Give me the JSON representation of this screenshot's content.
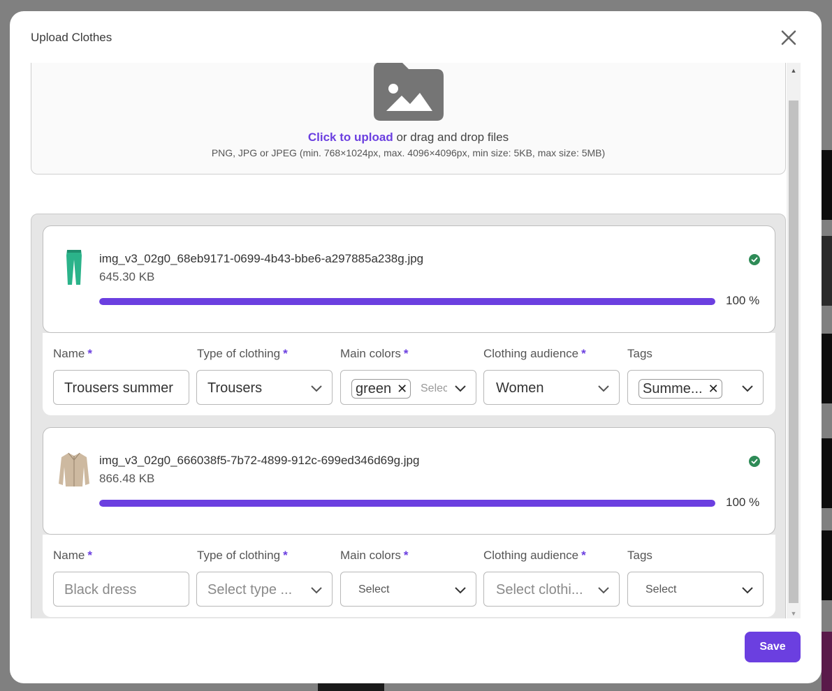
{
  "modal": {
    "title": "Upload Clothes",
    "save_label": "Save"
  },
  "dropzone": {
    "link_text": "Click to upload",
    "rest_text": " or drag and drop files",
    "hint": "PNG, JPG or JPEG (min. 768×1024px, max. 4096×4096px, min size: 5KB, max size: 5MB)"
  },
  "labels": {
    "name": "Name",
    "type": "Type of clothing",
    "colors": "Main colors",
    "audience": "Clothing audience",
    "tags": "Tags",
    "required": "*"
  },
  "files": [
    {
      "filename": "img_v3_02g0_68eb9171-0699-4b43-bbe6-a297885a238g.jpg",
      "size": "645.30 KB",
      "progress": 100,
      "progress_label": "100 %",
      "name_value": "Trousers summer",
      "type_value": "Trousers",
      "color_chip": "green",
      "color_placeholder": "Select",
      "audience_value": "Women",
      "tag_chip": "Summe..."
    },
    {
      "filename": "img_v3_02g0_666038f5-7b72-4899-912c-699ed346d69g.jpg",
      "size": "866.48 KB",
      "progress": 100,
      "progress_label": "100 %",
      "name_placeholder": "Black dress",
      "type_placeholder": "Select type ...",
      "colors_placeholder": "Select",
      "audience_placeholder": "Select clothi...",
      "tags_placeholder": "Select"
    }
  ],
  "colors": {
    "accent": "#6b3fe0",
    "success": "#2e8b57"
  }
}
